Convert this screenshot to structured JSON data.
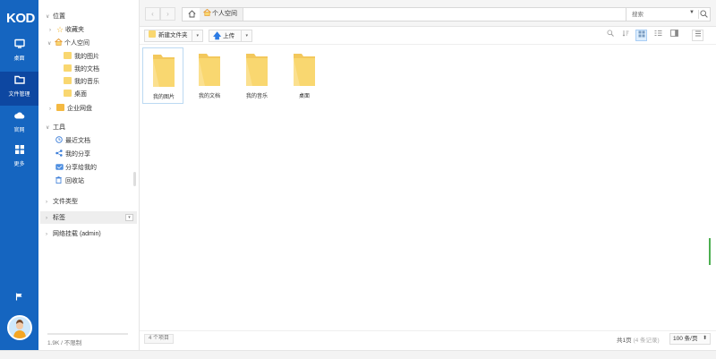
{
  "app": {
    "logo": "KOD"
  },
  "nav": {
    "items": [
      {
        "label": "桌面",
        "icon": "monitor-icon"
      },
      {
        "label": "文件管理",
        "icon": "folder-icon"
      },
      {
        "label": "官网",
        "icon": "cloud-icon"
      },
      {
        "label": "更多",
        "icon": "grid-icon"
      }
    ]
  },
  "tree": {
    "location_label": "位置",
    "favorites_label": "收藏夹",
    "personal_space_label": "个人空间",
    "personal_children": [
      "我的图片",
      "我的文档",
      "我的音乐",
      "桌面"
    ],
    "enterprise_label": "企业网盘",
    "tools_label": "工具",
    "tools": [
      "最近文档",
      "我的分享",
      "分享给我的",
      "回收站"
    ],
    "file_types_label": "文件类型",
    "tags_label": "标签",
    "network_mount_label": "网络挂载 (admin)",
    "storage_text": "1.9K / 不限制"
  },
  "address": {
    "crumb": "个人空间"
  },
  "search": {
    "placeholder": "搜索"
  },
  "toolbar": {
    "new_folder_label": "新建文件夹",
    "upload_label": "上传"
  },
  "files": [
    "我的图片",
    "我的文档",
    "我的音乐",
    "桌面"
  ],
  "status": {
    "count_text": "4 个项目",
    "page_text": "共1页",
    "records_text": "(4 条记录)",
    "per_page": "100 条/页"
  },
  "colors": {
    "nav_bg": "#1565c0",
    "folder": "#f9d770",
    "accent": "#2196f3"
  }
}
